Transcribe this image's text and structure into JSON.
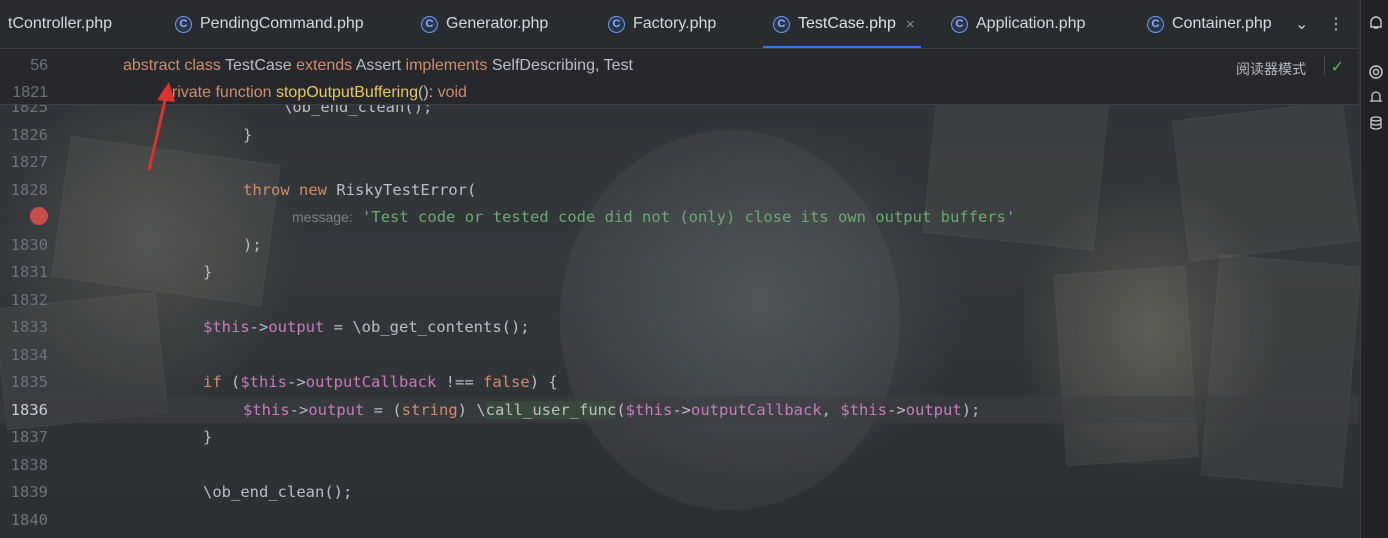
{
  "tabs": [
    {
      "label": "tController.php",
      "icon": "",
      "active": false
    },
    {
      "label": "PendingCommand.php",
      "icon": "class-icon",
      "active": false
    },
    {
      "label": "Generator.php",
      "icon": "class-icon",
      "active": false
    },
    {
      "label": "Factory.php",
      "icon": "class-icon",
      "active": false
    },
    {
      "label": "TestCase.php",
      "icon": "class-icon",
      "active": true
    },
    {
      "label": "Application.php",
      "icon": "class-icon",
      "active": false
    },
    {
      "label": "Container.php",
      "icon": "class-icon",
      "active": false
    }
  ],
  "tab_icon_letter": "C",
  "tab_close": "×",
  "tab_overflow": "⌄",
  "tab_menu": "⋮",
  "reader_mode": "阅读器模式",
  "check": "✓",
  "sticky": [
    {
      "num": "56"
    },
    {
      "num": "1821"
    }
  ],
  "lines": [
    {
      "num": "1825"
    },
    {
      "num": "1826"
    },
    {
      "num": "1827"
    },
    {
      "num": "1828"
    },
    {
      "num": ""
    },
    {
      "num": "1830"
    },
    {
      "num": "1831"
    },
    {
      "num": "1832"
    },
    {
      "num": "1833"
    },
    {
      "num": "1834"
    },
    {
      "num": "1835"
    },
    {
      "num": "1836"
    },
    {
      "num": "1837"
    },
    {
      "num": "1838"
    },
    {
      "num": "1839"
    },
    {
      "num": "1840"
    }
  ],
  "code": {
    "s56": {
      "kw1": "abstract",
      "kw2": "class",
      "name": "TestCase",
      "kw3": "extends",
      "parent": "Assert",
      "kw4": "implements",
      "iface": "SelfDescribing",
      "sep": ",",
      "iface2": "Test"
    },
    "s1821": {
      "kw1": "private",
      "kw2": "function",
      "name": "stopOutputBuffering",
      "sig": "():",
      "ret": "void"
    },
    "l1825": "\\ob_end_clean();",
    "l1826": "}",
    "l1828": {
      "kw1": "throw",
      "kw2": "new",
      "cls": "RiskyTestError("
    },
    "l1829": {
      "hint": "message:",
      "str": "'Test code or tested code did not (only) close its own output buffers'"
    },
    "l1830": ");",
    "l1831": "}",
    "l1833": {
      "var": "$this",
      "arrow": "->",
      "prop": "output",
      "rest": " = \\ob_get_contents();"
    },
    "l1835": {
      "kw": "if",
      "open": " (",
      "var": "$this",
      "arrow": "->",
      "prop": "outputCallback",
      "op": " !== ",
      "kw2": "false",
      "close": ") {"
    },
    "l1836": {
      "var": "$this",
      "arrow": "->",
      "prop": "output",
      "mid": " = (",
      "cast": "string",
      "mid2": ") \\",
      "fn": "call_user_func",
      "p1": "(",
      "var2": "$this",
      "arrow2": "->",
      "prop2": "outputCallback",
      "comma": ", ",
      "var3": "$this",
      "arrow3": "->",
      "prop3": "output",
      "end": ");"
    },
    "l1837": "}",
    "l1839": "\\ob_end_clean();"
  }
}
